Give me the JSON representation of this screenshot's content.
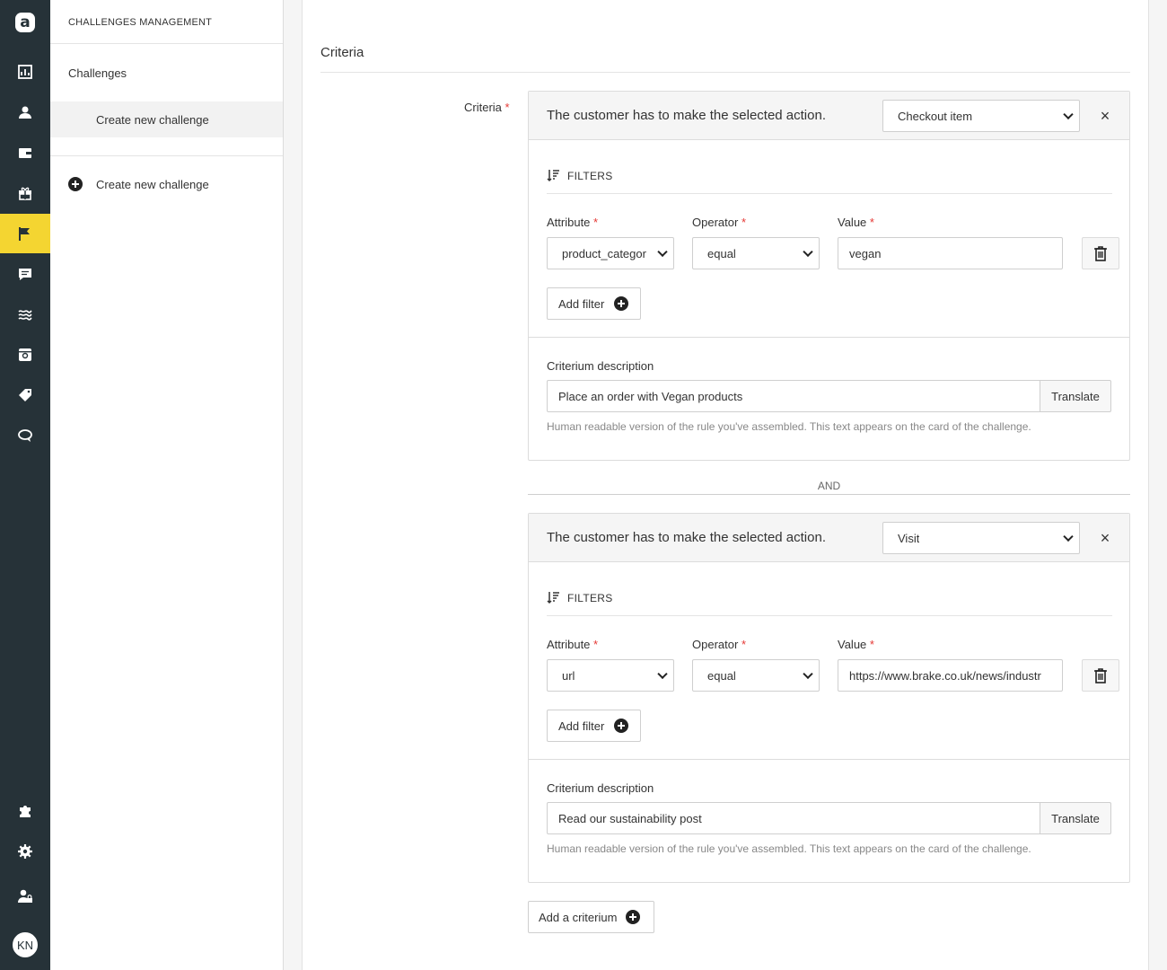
{
  "rail": {
    "logo": "a",
    "items": [
      "dashboard-icon",
      "customers-icon",
      "wallet-icon",
      "gift-icon",
      "flag-icon",
      "comment-icon",
      "waves-icon",
      "instagram-icon",
      "tag-icon",
      "chat-icon",
      "puzzle-icon",
      "gear-icon",
      "user-lock-icon"
    ],
    "active": "flag-icon",
    "avatar": "KN",
    "accent_color": "#f4d531",
    "rail_color": "#263238"
  },
  "sidebar": {
    "title": "CHALLENGES MANAGEMENT",
    "link_challenges": "Challenges",
    "sub_create": "Create new challenge",
    "create_action": "Create new challenge"
  },
  "main": {
    "section_title": "Criteria",
    "criteria_label": "Criteria",
    "required_mark": "*",
    "and_label": "AND",
    "add_criterium": "Add a criterium",
    "criteria": [
      {
        "header_text": "The customer has to make the selected action.",
        "action": "Checkout item",
        "close": "×",
        "filters_title": "FILTERS",
        "attribute_label": "Attribute",
        "operator_label": "Operator",
        "value_label": "Value",
        "attribute": "product_categor",
        "operator": "equal",
        "value": "vegan",
        "add_filter": "Add filter",
        "description_label": "Criterium description",
        "description": "Place an order with Vegan products",
        "translate": "Translate",
        "hint": "Human readable version of the rule you've assembled. This text appears on the card of the challenge."
      },
      {
        "header_text": "The customer has to make the selected action.",
        "action": "Visit",
        "close": "×",
        "filters_title": "FILTERS",
        "attribute_label": "Attribute",
        "operator_label": "Operator",
        "value_label": "Value",
        "attribute": "url",
        "operator": "equal",
        "value": "https://www.brake.co.uk/news/industr",
        "add_filter": "Add filter",
        "description_label": "Criterium description",
        "description": "Read our sustainability post",
        "translate": "Translate",
        "hint": "Human readable version of the rule you've assembled. This text appears on the card of the challenge."
      }
    ]
  }
}
